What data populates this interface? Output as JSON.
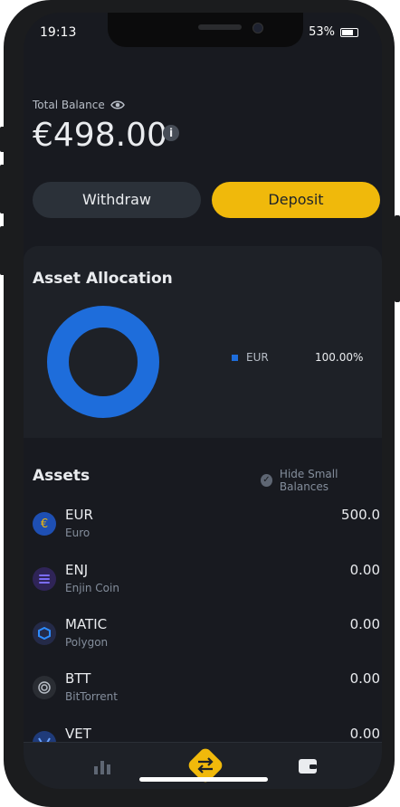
{
  "status": {
    "time": "19:13",
    "battery": "53%"
  },
  "balance": {
    "label": "Total Balance",
    "value": "€498.00"
  },
  "actions": {
    "withdraw": "Withdraw",
    "deposit": "Deposit"
  },
  "allocation": {
    "title": "Asset Allocation",
    "items": [
      {
        "name": "EUR",
        "percent": "100.00%",
        "color": "#1e6ddb"
      }
    ]
  },
  "chart_data": {
    "type": "pie",
    "categories": [
      "EUR"
    ],
    "values": [
      100.0
    ],
    "title": "Asset Allocation"
  },
  "assets": {
    "title": "Assets",
    "hide_small": "Hide Small Balances",
    "rows": [
      {
        "symbol": "EUR",
        "name": "Euro",
        "amount": "500.0",
        "icon": "euro-icon",
        "color": "#1e4fb3"
      },
      {
        "symbol": "ENJ",
        "name": "Enjin Coin",
        "amount": "0.00",
        "icon": "enj-icon",
        "color": "#2f2457"
      },
      {
        "symbol": "MATIC",
        "name": "Polygon",
        "amount": "0.00",
        "icon": "matic-icon",
        "color": "#242a48"
      },
      {
        "symbol": "BTT",
        "name": "BitTorrent",
        "amount": "0.00",
        "icon": "btt-icon",
        "color": "#2a2d33"
      },
      {
        "symbol": "VET",
        "name": "",
        "amount": "0.00",
        "icon": "vet-icon",
        "color": "#1f3b7a"
      }
    ]
  },
  "nav": {
    "items": [
      "markets-icon",
      "trade-icon",
      "wallet-icon"
    ]
  }
}
